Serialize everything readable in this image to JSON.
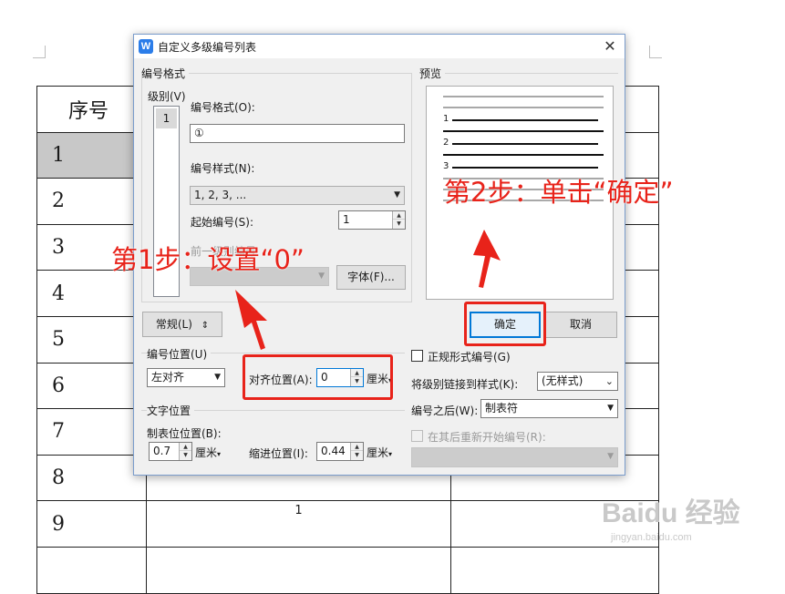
{
  "document": {
    "header": "序号",
    "rows": [
      "1",
      "2",
      "3",
      "4",
      "5",
      "6",
      "7",
      "8",
      "9",
      ""
    ],
    "inner_cell_text": "1"
  },
  "dialog": {
    "title": "自定义多级编号列表",
    "close_glyph": "✕",
    "numbering_format_group": "编号格式",
    "level_label": "级别(V)",
    "level_items": [
      "1"
    ],
    "format_label": "编号格式(O):",
    "format_value": "①",
    "style_label": "编号样式(N):",
    "style_value": "1, 2, 3, ...",
    "start_label": "起始编号(S):",
    "start_value": "1",
    "prev_level_label": "前一级别编号",
    "font_button": "字体(F)...",
    "preview_group": "预览",
    "preview_numbers": [
      "1",
      "2",
      "3"
    ],
    "normal_button": "常规(L)",
    "normal_button_icon": "⇕",
    "ok_button": "确定",
    "cancel_button": "取消",
    "number_position_group": "编号位置(U)",
    "alignment_value": "左对齐",
    "align_position_label": "对齐位置(A):",
    "align_position_value": "0",
    "unit_cm": "厘米",
    "legal_style_label": "正规形式编号(G)",
    "link_style_label": "将级别链接到样式(K):",
    "link_style_value": "(无样式)",
    "text_position_group": "文字位置",
    "follow_label": "编号之后(W):",
    "follow_value": "制表符",
    "tab_position_label": "制表位位置(B):",
    "tab_position_value": "0.7",
    "indent_label": "缩进位置(I):",
    "indent_value": "0.44",
    "restart_label": "在其后重新开始编号(R):"
  },
  "annotations": {
    "step1": "第1步：设置“0”",
    "step2": "第2步：单击“确定”",
    "color": "#e8231a"
  },
  "watermark": {
    "main": "Baidu 经验",
    "sub": "jingyan.baidu.com"
  }
}
